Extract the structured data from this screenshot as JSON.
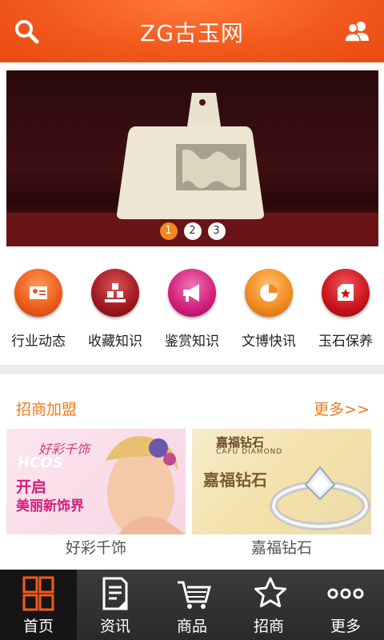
{
  "header": {
    "title": "ZG古玉网"
  },
  "banner": {
    "pages": [
      "1",
      "2",
      "3"
    ],
    "active_page": "1"
  },
  "categories": [
    {
      "label": "行业动态",
      "icon": "id-card-icon",
      "color": "#ec5a1a"
    },
    {
      "label": "收藏知识",
      "icon": "boxes-icon",
      "color": "#a0171e"
    },
    {
      "label": "鉴赏知识",
      "icon": "megaphone-icon",
      "color": "#d21e7a"
    },
    {
      "label": "文博快讯",
      "icon": "pie-chart-icon",
      "color": "#f08a1c"
    },
    {
      "label": "玉石保养",
      "icon": "house-star-icon",
      "color": "#c8141a"
    }
  ],
  "section": {
    "title": "招商加盟",
    "more_label": "更多>>"
  },
  "ads": [
    {
      "caption": "好彩千饰",
      "brand_text": "好彩千饰",
      "brand_latin": "HCOS",
      "slogan_line1": "开启",
      "slogan_line2": "美丽新饰界"
    },
    {
      "caption": "嘉福钻石",
      "brand_text": "嘉福钻石",
      "brand_latin": "CAFU DIAMOND",
      "headline": "嘉福钻石"
    }
  ],
  "tabs": [
    {
      "label": "首页",
      "icon": "grid-icon",
      "active": true
    },
    {
      "label": "资讯",
      "icon": "document-icon",
      "active": false
    },
    {
      "label": "商品",
      "icon": "cart-icon",
      "active": false
    },
    {
      "label": "招商",
      "icon": "star-icon",
      "active": false
    },
    {
      "label": "更多",
      "icon": "more-icon",
      "active": false
    }
  ],
  "colors": {
    "header": "#f25a1d",
    "accent": "#f07a18",
    "tab_active": "#f25a1d"
  }
}
